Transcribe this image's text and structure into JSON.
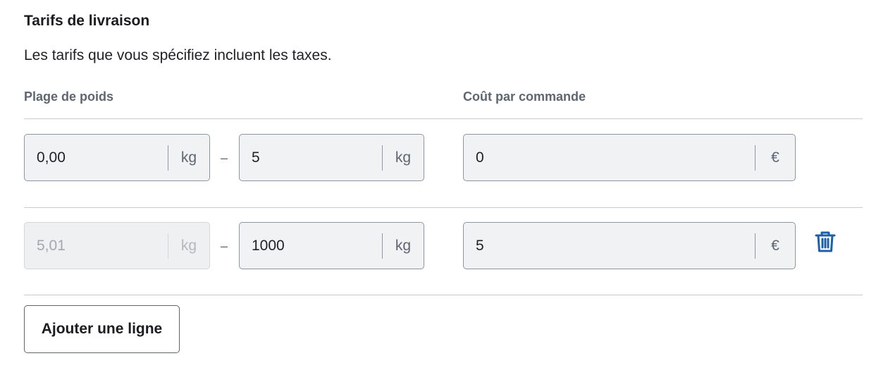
{
  "section": {
    "title": "Tarifs de livraison",
    "description": "Les tarifs que vous spécifiez incluent les taxes."
  },
  "columns": {
    "weight_range": "Plage de poids",
    "cost_per_order": "Coût par commande"
  },
  "rows": [
    {
      "min": "0,00",
      "min_unit": "kg",
      "dash": "–",
      "max": "5",
      "max_unit": "kg",
      "cost": "0",
      "currency": "€",
      "min_disabled": false,
      "deletable": false
    },
    {
      "min": "5,01",
      "min_unit": "kg",
      "dash": "–",
      "max": "1000",
      "max_unit": "kg",
      "cost": "5",
      "currency": "€",
      "min_disabled": true,
      "deletable": true
    }
  ],
  "actions": {
    "add_row_label": "Ajouter une ligne"
  },
  "icons": {
    "delete": "trash-icon"
  },
  "colors": {
    "accent": "#1f5fa8",
    "field_bg": "#f1f2f4",
    "field_border": "#8e96a1",
    "muted_text": "#5d6672"
  }
}
